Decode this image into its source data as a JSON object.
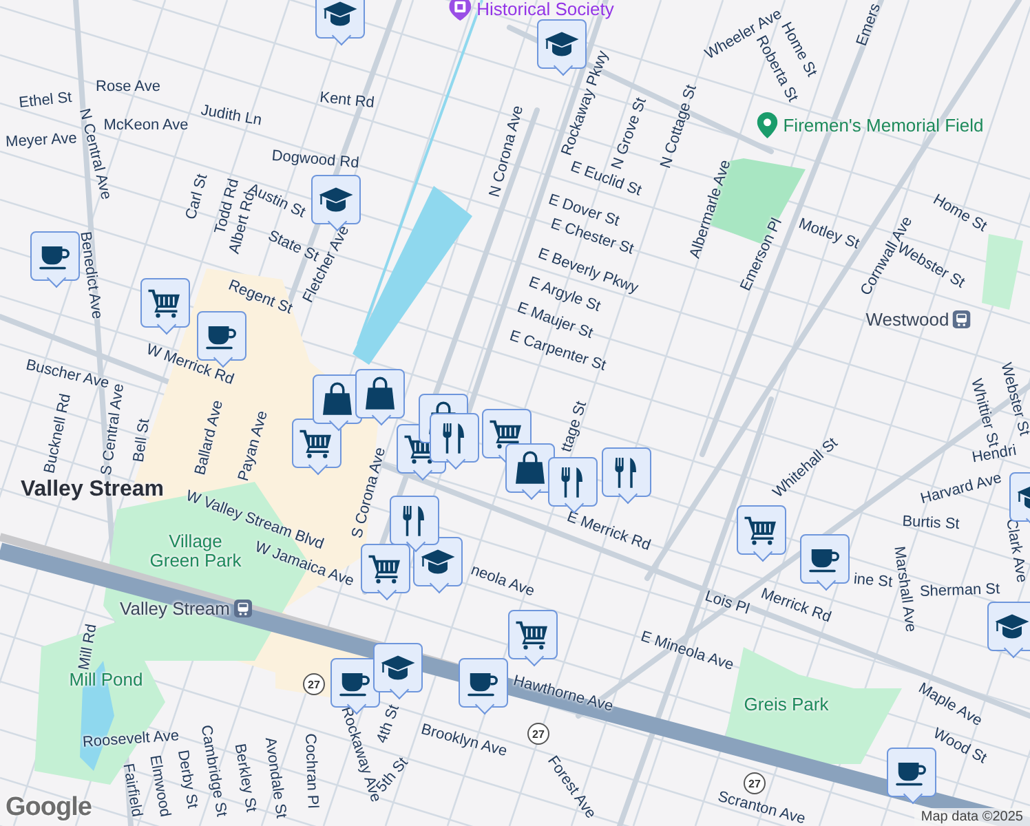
{
  "map": {
    "labels": [
      {
        "text": "Rose Ave",
        "kind": "street"
      },
      {
        "text": "Ethel St",
        "kind": "street"
      },
      {
        "text": "Kent Rd",
        "kind": "street"
      },
      {
        "text": "Judith Ln",
        "kind": "street"
      },
      {
        "text": "McKeon Ave",
        "kind": "street"
      },
      {
        "text": "Meyer Ave",
        "kind": "street"
      },
      {
        "text": "Dogwood Rd",
        "kind": "street"
      },
      {
        "text": "N Central Ave",
        "kind": "street"
      },
      {
        "text": "Carl St",
        "kind": "street"
      },
      {
        "text": "Todd Rd",
        "kind": "street"
      },
      {
        "text": "Albert Rd",
        "kind": "street"
      },
      {
        "text": "Austin St",
        "kind": "street"
      },
      {
        "text": "State St",
        "kind": "street"
      },
      {
        "text": "Fletcher Ave",
        "kind": "street"
      },
      {
        "text": "Benedict Ave",
        "kind": "street"
      },
      {
        "text": "Regent St",
        "kind": "street"
      },
      {
        "text": "W Merrick Rd",
        "kind": "street"
      },
      {
        "text": "Buscher Ave",
        "kind": "street"
      },
      {
        "text": "N Corona Ave",
        "kind": "street"
      },
      {
        "text": "Rockaway Pkwy",
        "kind": "street"
      },
      {
        "text": "Wheeler Ave",
        "kind": "street"
      },
      {
        "text": "Roberta St",
        "kind": "street"
      },
      {
        "text": "Home St",
        "kind": "street"
      },
      {
        "text": "N Grove St",
        "kind": "street"
      },
      {
        "text": "N Cottage St",
        "kind": "street"
      },
      {
        "text": "E Euclid St",
        "kind": "street"
      },
      {
        "text": "E Dover St",
        "kind": "street"
      },
      {
        "text": "E Chester St",
        "kind": "street"
      },
      {
        "text": "E Beverly Pkwy",
        "kind": "street"
      },
      {
        "text": "E Argyle St",
        "kind": "street"
      },
      {
        "text": "E Maujer St",
        "kind": "street"
      },
      {
        "text": "E Carpenter St",
        "kind": "street"
      },
      {
        "text": "Albermarle Ave",
        "kind": "street"
      },
      {
        "text": "Emerson Pl",
        "kind": "street"
      },
      {
        "text": "Emers",
        "kind": "street"
      },
      {
        "text": "Motley St",
        "kind": "street"
      },
      {
        "text": "Cornwall Ave",
        "kind": "street"
      },
      {
        "text": "Home St",
        "kind": "street"
      },
      {
        "text": "Webster St",
        "kind": "street"
      },
      {
        "text": "Whittier St",
        "kind": "street"
      },
      {
        "text": "Webster St",
        "kind": "street"
      },
      {
        "text": "Hendri",
        "kind": "street"
      },
      {
        "text": "Harvard Ave",
        "kind": "street"
      },
      {
        "text": "Whitehall St",
        "kind": "street"
      },
      {
        "text": "Burtis St",
        "kind": "street"
      },
      {
        "text": "ine St",
        "kind": "street"
      },
      {
        "text": "Sherman St",
        "kind": "street"
      },
      {
        "text": "Marshall Ave",
        "kind": "street"
      },
      {
        "text": "Clark Ave",
        "kind": "street"
      },
      {
        "text": "Merrick Rd",
        "kind": "street"
      },
      {
        "text": "E Merrick Rd",
        "kind": "street"
      },
      {
        "text": "Lois Pl",
        "kind": "street"
      },
      {
        "text": "E Mineola Ave",
        "kind": "street"
      },
      {
        "text": "Hawthorne Ave",
        "kind": "street"
      },
      {
        "text": "Maple Ave",
        "kind": "street"
      },
      {
        "text": "Wood St",
        "kind": "street"
      },
      {
        "text": "Brooklyn Ave",
        "kind": "street"
      },
      {
        "text": "Roosevelt Ave",
        "kind": "street"
      },
      {
        "text": "Mill Rd",
        "kind": "street"
      },
      {
        "text": "Fairfield",
        "kind": "street"
      },
      {
        "text": "Elmwood",
        "kind": "street"
      },
      {
        "text": "Derby St",
        "kind": "street"
      },
      {
        "text": "Cambridge St",
        "kind": "street"
      },
      {
        "text": "Berkley St",
        "kind": "street"
      },
      {
        "text": "Avondale St",
        "kind": "street"
      },
      {
        "text": "Cochran Pl",
        "kind": "street"
      },
      {
        "text": "Rockaway Ave",
        "kind": "street"
      },
      {
        "text": "4th St",
        "kind": "street"
      },
      {
        "text": "5th St",
        "kind": "street"
      },
      {
        "text": "W Valley Stream Blvd",
        "kind": "street"
      },
      {
        "text": "W Jamaica Ave",
        "kind": "street"
      },
      {
        "text": "neola Ave",
        "kind": "street"
      },
      {
        "text": "Bell St",
        "kind": "street"
      },
      {
        "text": "S Central Ave",
        "kind": "street"
      },
      {
        "text": "Bucknell Rd",
        "kind": "street"
      },
      {
        "text": "Ballard Ave",
        "kind": "street"
      },
      {
        "text": "Payan Ave",
        "kind": "street"
      },
      {
        "text": "S Corona Ave",
        "kind": "street"
      },
      {
        "text": "Forest Ave",
        "kind": "street"
      },
      {
        "text": "Scranton Ave",
        "kind": "street"
      },
      {
        "text": "ttage St",
        "kind": "street"
      },
      {
        "text": "Valley Stream",
        "kind": "place"
      },
      {
        "text": "Village Green Park",
        "kind": "park"
      },
      {
        "text": "Mill Pond",
        "kind": "park"
      },
      {
        "text": "Greis Park",
        "kind": "park"
      },
      {
        "text": "Valley Stream",
        "kind": "transit"
      },
      {
        "text": "Firemen's Memorial Field",
        "kind": "poi"
      },
      {
        "text": "Westwood",
        "kind": "transit"
      },
      {
        "text": "Historical Society",
        "kind": "museum"
      }
    ],
    "markers": [
      {
        "kind": "cafe"
      },
      {
        "kind": "cafe"
      },
      {
        "kind": "cafe"
      },
      {
        "kind": "cafe"
      },
      {
        "kind": "cafe"
      },
      {
        "kind": "cafe"
      },
      {
        "kind": "cart"
      },
      {
        "kind": "cart"
      },
      {
        "kind": "cart"
      },
      {
        "kind": "cart"
      },
      {
        "kind": "cart"
      },
      {
        "kind": "cart"
      },
      {
        "kind": "cart"
      },
      {
        "kind": "school"
      },
      {
        "kind": "school"
      },
      {
        "kind": "school"
      },
      {
        "kind": "school"
      },
      {
        "kind": "school"
      },
      {
        "kind": "school"
      },
      {
        "kind": "school"
      },
      {
        "kind": "bag"
      },
      {
        "kind": "bag"
      },
      {
        "kind": "bag"
      },
      {
        "kind": "bag"
      },
      {
        "kind": "restaurant"
      },
      {
        "kind": "restaurant"
      },
      {
        "kind": "restaurant"
      },
      {
        "kind": "restaurant"
      }
    ],
    "shields": [
      "27",
      "27",
      "27"
    ],
    "logo": "Google",
    "attribution": "Map data ©2025"
  }
}
